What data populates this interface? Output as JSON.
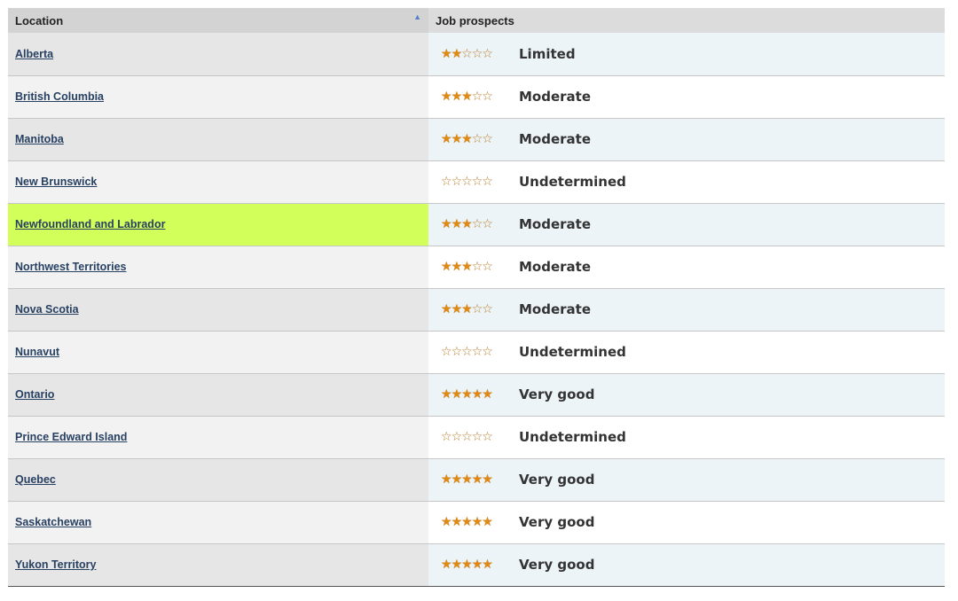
{
  "table": {
    "headers": {
      "location": "Location",
      "prospects": "Job prospects",
      "sort_indicator": "▲"
    },
    "rows": [
      {
        "location": "Alberta",
        "rating": 2,
        "max_rating": 5,
        "prospect": "Limited",
        "highlighted": false
      },
      {
        "location": "British Columbia",
        "rating": 3,
        "max_rating": 5,
        "prospect": "Moderate",
        "highlighted": false
      },
      {
        "location": "Manitoba",
        "rating": 3,
        "max_rating": 5,
        "prospect": "Moderate",
        "highlighted": false
      },
      {
        "location": "New Brunswick",
        "rating": 0,
        "max_rating": 5,
        "prospect": "Undetermined",
        "highlighted": false
      },
      {
        "location": "Newfoundland and Labrador",
        "rating": 3,
        "max_rating": 5,
        "prospect": "Moderate",
        "highlighted": true
      },
      {
        "location": "Northwest Territories",
        "rating": 3,
        "max_rating": 5,
        "prospect": "Moderate",
        "highlighted": false
      },
      {
        "location": "Nova Scotia",
        "rating": 3,
        "max_rating": 5,
        "prospect": "Moderate",
        "highlighted": false
      },
      {
        "location": "Nunavut",
        "rating": 0,
        "max_rating": 5,
        "prospect": "Undetermined",
        "highlighted": false
      },
      {
        "location": "Ontario",
        "rating": 5,
        "max_rating": 5,
        "prospect": "Very good",
        "highlighted": false
      },
      {
        "location": "Prince Edward Island",
        "rating": 0,
        "max_rating": 5,
        "prospect": "Undetermined",
        "highlighted": false
      },
      {
        "location": "Quebec",
        "rating": 5,
        "max_rating": 5,
        "prospect": "Very good",
        "highlighted": false
      },
      {
        "location": "Saskatchewan",
        "rating": 5,
        "max_rating": 5,
        "prospect": "Very good",
        "highlighted": false
      },
      {
        "location": "Yukon Territory",
        "rating": 5,
        "max_rating": 5,
        "prospect": "Very good",
        "highlighted": false
      }
    ]
  },
  "icons": {
    "star_filled": "star-filled-icon",
    "star_empty": "star-empty-icon",
    "sort": "sort-ascending-icon"
  },
  "colors": {
    "link": "#284162",
    "highlight": "#d3ff5a",
    "star": "#e08a14"
  }
}
